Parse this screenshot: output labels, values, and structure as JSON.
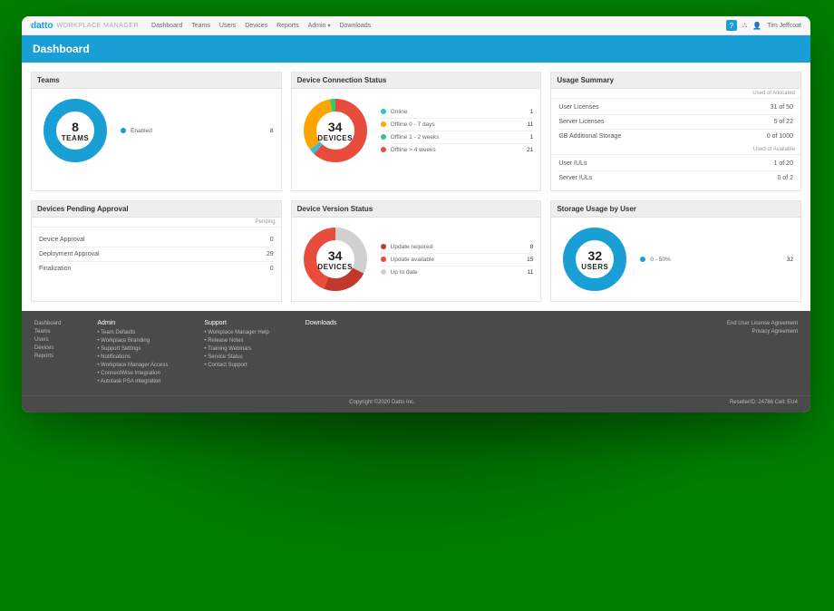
{
  "brand": {
    "logo": "datto",
    "subtitle": "WORKPLACE MANAGER"
  },
  "nav": {
    "dashboard": "Dashboard",
    "teams": "Teams",
    "users": "Users",
    "devices": "Devices",
    "reports": "Reports",
    "admin": "Admin",
    "downloads": "Downloads"
  },
  "topbar": {
    "help": "?",
    "user": "Tim Jeffcoat"
  },
  "page_title": "Dashboard",
  "cards": {
    "teams": {
      "title": "Teams",
      "center_num": "8",
      "center_label": "TEAMS",
      "legend": [
        {
          "label": "Enabled",
          "value": "8",
          "color": "#199fd6"
        }
      ]
    },
    "connection": {
      "title": "Device Connection Status",
      "center_num": "34",
      "center_label": "DEVICES",
      "legend": [
        {
          "label": "Online",
          "value": "1",
          "color": "#33bde0"
        },
        {
          "label": "Offline 0 - 7 days",
          "value": "11",
          "color": "#ffa500"
        },
        {
          "label": "Offline 1 - 2 weeks",
          "value": "1",
          "color": "#2ecc71"
        },
        {
          "label": "Offline > 4 weeks",
          "value": "21",
          "color": "#e74c3c"
        }
      ]
    },
    "usage": {
      "title": "Usage Summary",
      "sub1": "Used of Allocated",
      "rows1": [
        {
          "label": "User Licenses",
          "value": "31 of 50"
        },
        {
          "label": "Server Licenses",
          "value": "5 of 22"
        },
        {
          "label": "GB Additional Storage",
          "value": "0 of 1000"
        }
      ],
      "sub2": "Used of Available",
      "rows2": [
        {
          "label": "User IULs",
          "value": "1 of 20"
        },
        {
          "label": "Server IULs",
          "value": "0 of 2"
        }
      ]
    },
    "pending": {
      "title": "Devices Pending Approval",
      "sub": "Pending",
      "rows": [
        {
          "label": "Device Approval",
          "value": "0"
        },
        {
          "label": "Deployment Approval",
          "value": "29"
        },
        {
          "label": "Finalization",
          "value": "0"
        }
      ]
    },
    "version": {
      "title": "Device Version Status",
      "center_num": "34",
      "center_label": "DEVICES",
      "legend": [
        {
          "label": "Update required",
          "value": "8",
          "color": "#c0392b"
        },
        {
          "label": "Update available",
          "value": "15",
          "color": "#e74c3c"
        },
        {
          "label": "Up to date",
          "value": "11",
          "color": "#d0d0d0"
        }
      ]
    },
    "storage": {
      "title": "Storage Usage by User",
      "center_num": "32",
      "center_label": "USERS",
      "legend": [
        {
          "label": "0 - 50%",
          "value": "32",
          "color": "#199fd6"
        }
      ]
    }
  },
  "chart_data": [
    {
      "type": "pie",
      "title": "Teams",
      "categories": [
        "Enabled"
      ],
      "values": [
        8
      ]
    },
    {
      "type": "pie",
      "title": "Device Connection Status",
      "categories": [
        "Online",
        "Offline 0 - 7 days",
        "Offline 1 - 2 weeks",
        "Offline > 4 weeks"
      ],
      "values": [
        1,
        11,
        1,
        21
      ]
    },
    {
      "type": "pie",
      "title": "Device Version Status",
      "categories": [
        "Update required",
        "Update available",
        "Up to date"
      ],
      "values": [
        8,
        15,
        11
      ]
    },
    {
      "type": "pie",
      "title": "Storage Usage by User",
      "categories": [
        "0 - 50%"
      ],
      "values": [
        32
      ]
    }
  ],
  "footer": {
    "col1": [
      "Dashboard",
      "Teams",
      "Users",
      "Devices",
      "Reports"
    ],
    "col2_title": "Admin",
    "col2": [
      "Team Defaults",
      "Workplace Branding",
      "Support Settings",
      "Notifications",
      "Workplace Manager Access",
      "ConnectWise Integration",
      "Autotask PSA Integration"
    ],
    "col3_title": "Support",
    "col3": [
      "Workplace Manager Help",
      "Release Notes",
      "Training Webinars",
      "Service Status",
      "Contact Support"
    ],
    "col4_title": "Downloads",
    "col5": [
      "End User License Agreement",
      "Privacy Agreement"
    ],
    "copyright": "Copyright ©2020 Datto Inc.",
    "reseller": "ResellerID: 24786   Cell: EU4"
  }
}
